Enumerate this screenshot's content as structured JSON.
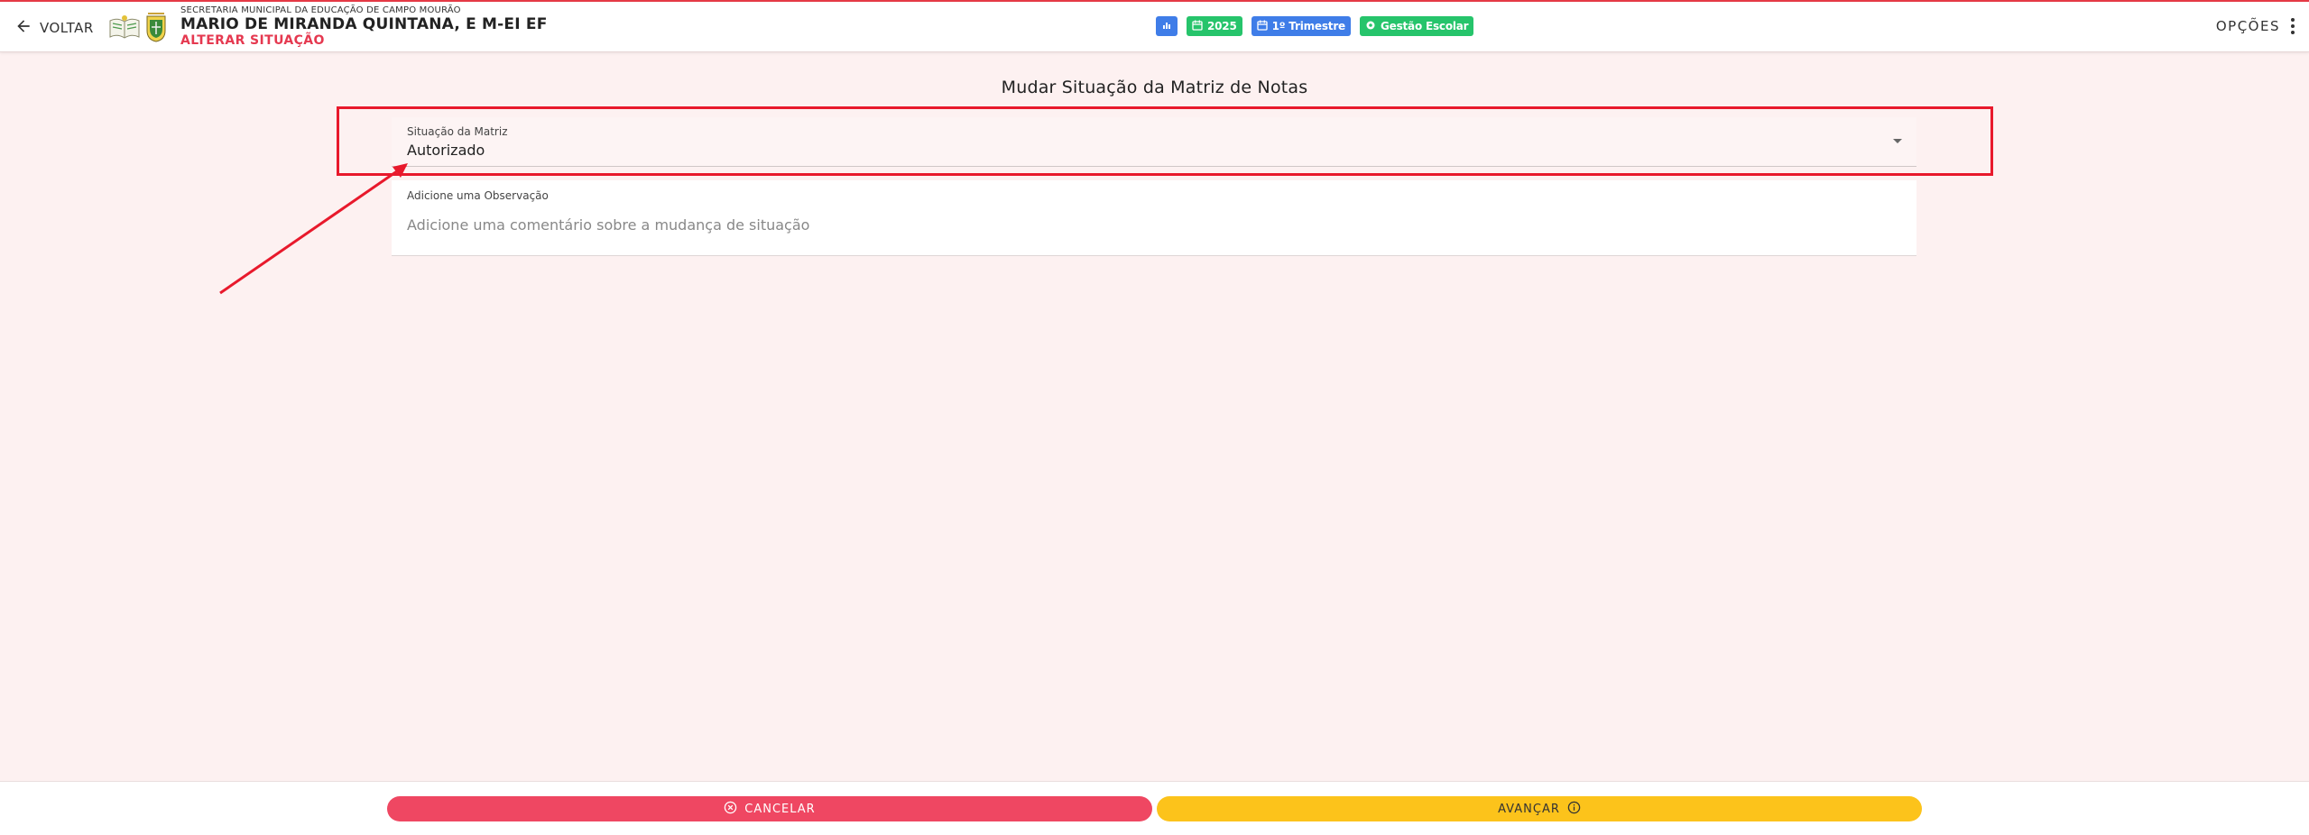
{
  "header": {
    "back_label": "VOLTAR",
    "school_subtitle": "SECRETARIA MUNICIPAL DA EDUCAÇÃO DE CAMPO MOURÃO",
    "school_name": "MARIO DE MIRANDA QUINTANA, E M-EI EF",
    "action_title": "ALTERAR SITUAÇÃO",
    "badges": [
      {
        "label": "",
        "icon": "chart-icon",
        "color": "#3f7de8"
      },
      {
        "label": "2025",
        "icon": "calendar-icon",
        "color": "#26c46b"
      },
      {
        "label": "1º Trimestre",
        "icon": "calendar-icon",
        "color": "#3f7de8"
      },
      {
        "label": "Gestão Escolar",
        "icon": "settings-icon",
        "color": "#26c46b"
      }
    ],
    "options_label": "OPÇÕES"
  },
  "main": {
    "title": "Mudar Situação da Matriz de Notas",
    "status_field": {
      "label": "Situação da Matriz",
      "value": "Autorizado"
    },
    "observation_field": {
      "label": "Adicione uma Observação",
      "placeholder": "Adicione uma comentário sobre a mudança de situação",
      "value": ""
    }
  },
  "footer": {
    "cancel_label": "CANCELAR",
    "next_label": "AVANÇAR"
  },
  "colors": {
    "accent_red": "#e53950",
    "highlight_red": "#e8192c",
    "cancel_button": "#ef4762",
    "next_button": "#fcc31b",
    "badge_blue": "#3f7de8",
    "badge_green": "#26c46b",
    "page_background": "#fdf1f1"
  }
}
